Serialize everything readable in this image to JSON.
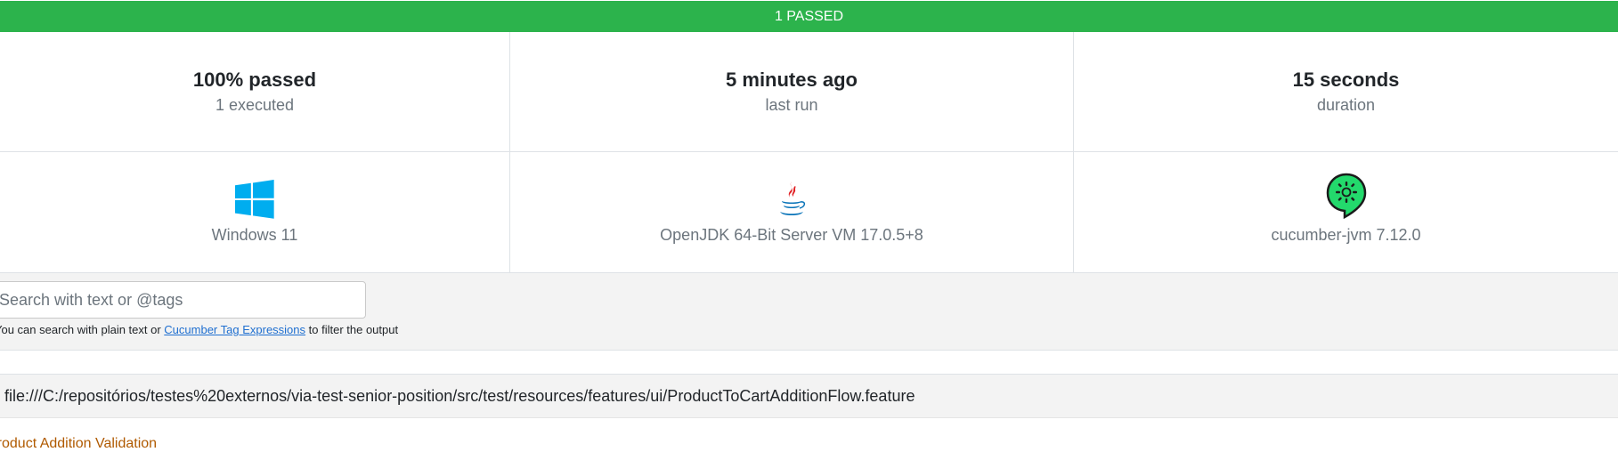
{
  "status": {
    "text": "1 PASSED",
    "color": "#2cb34c"
  },
  "stats": [
    {
      "value": "100% passed",
      "label": "1 executed"
    },
    {
      "value": "5 minutes ago",
      "label": "last run"
    },
    {
      "value": "15 seconds",
      "label": "duration"
    }
  ],
  "environment": [
    {
      "icon": "windows-icon",
      "label": "Windows 11"
    },
    {
      "icon": "java-icon",
      "label": "OpenJDK 64-Bit Server VM 17.0.5+8"
    },
    {
      "icon": "cucumber-icon",
      "label": "cucumber-jvm 7.12.0"
    }
  ],
  "search": {
    "placeholder": "Search with text or @tags",
    "help_prefix": "You can search with plain text or ",
    "help_link": "Cucumber Tag Expressions",
    "help_suffix": " to filter the output"
  },
  "feature": {
    "path": "file:///C:/repositórios/testes%20externos/via-test-senior-position/src/test/resources/features/ui/ProductToCartAdditionFlow.feature",
    "title": "Product Addition Validation"
  }
}
